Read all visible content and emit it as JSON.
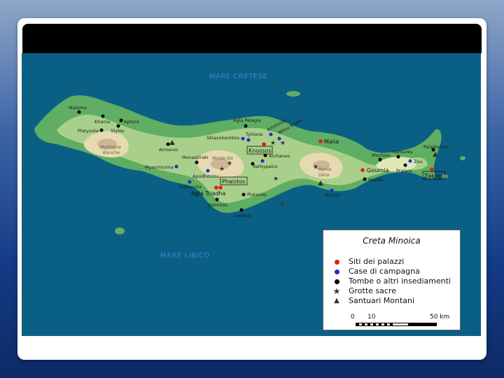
{
  "sea_labels": {
    "north": "MARE CRETESE",
    "south": "MARE LIBICO"
  },
  "places": {
    "maleme": "Maleme",
    "khania": "Khania",
    "aptera": "Aptera",
    "platyvola": "Platyvola",
    "stylos": "Stylos",
    "armenoi": "Armenoi",
    "myxorrouma": "Myxorrouma",
    "monastiraki": "Monastiraki",
    "apodhoulou": "Apodhoulou",
    "sakhouria": "Sakhouria",
    "agia_triadha": "Agia Triadha",
    "phaistos": "Phaistos",
    "kommos": "Kommos",
    "platanos": "Platanos",
    "lebena": "Lebena",
    "agia_pelagia": "Agia Pelagia",
    "sklavokambos": "Sklavokambos",
    "tylissos": "Tylissos",
    "knossos": "Knossos",
    "amnissos": "Amnissos",
    "nirou_khani": "Nirou Khani",
    "archanes": "Archanes",
    "vathypetro": "Vathypetro",
    "malia": "Malia",
    "gournia": "Gournia",
    "vasiliki": "Vasiliki",
    "mochlos": "Mochlos",
    "zou": "Zou",
    "praisos": "Praisos",
    "palaikastro": "Palaikastro",
    "zakros": "Zakros",
    "kamares": "Kamares",
    "myrtos": "Myrtos"
  },
  "mountains": {
    "bianche": "Montagne\nBianche",
    "ida": "Monte Ida",
    "dikte": "Monte\nDikte"
  },
  "legend": {
    "title": "Creta Minoica",
    "items": [
      {
        "label": "Siti dei palazzi",
        "symbol": "dot",
        "color": "#e31a1c"
      },
      {
        "label": "Case di campagna",
        "symbol": "dot",
        "color": "#1f2bd6"
      },
      {
        "label": "Tombe o altri insediamenti",
        "symbol": "dot",
        "color": "#000000"
      },
      {
        "label": "Grotte sacre",
        "symbol": "star",
        "color": "#333333"
      },
      {
        "label": "Santuari Montani",
        "symbol": "triangle",
        "color": "#333333"
      }
    ],
    "scale": {
      "zero": "0",
      "ten": "10",
      "fifty": "50 km"
    }
  },
  "colors": {
    "sea": "#0a5f84",
    "lowland": "#6fb56a",
    "midland": "#b9d99a",
    "highland": "#e8dcb4",
    "peak": "#cdb89a"
  }
}
